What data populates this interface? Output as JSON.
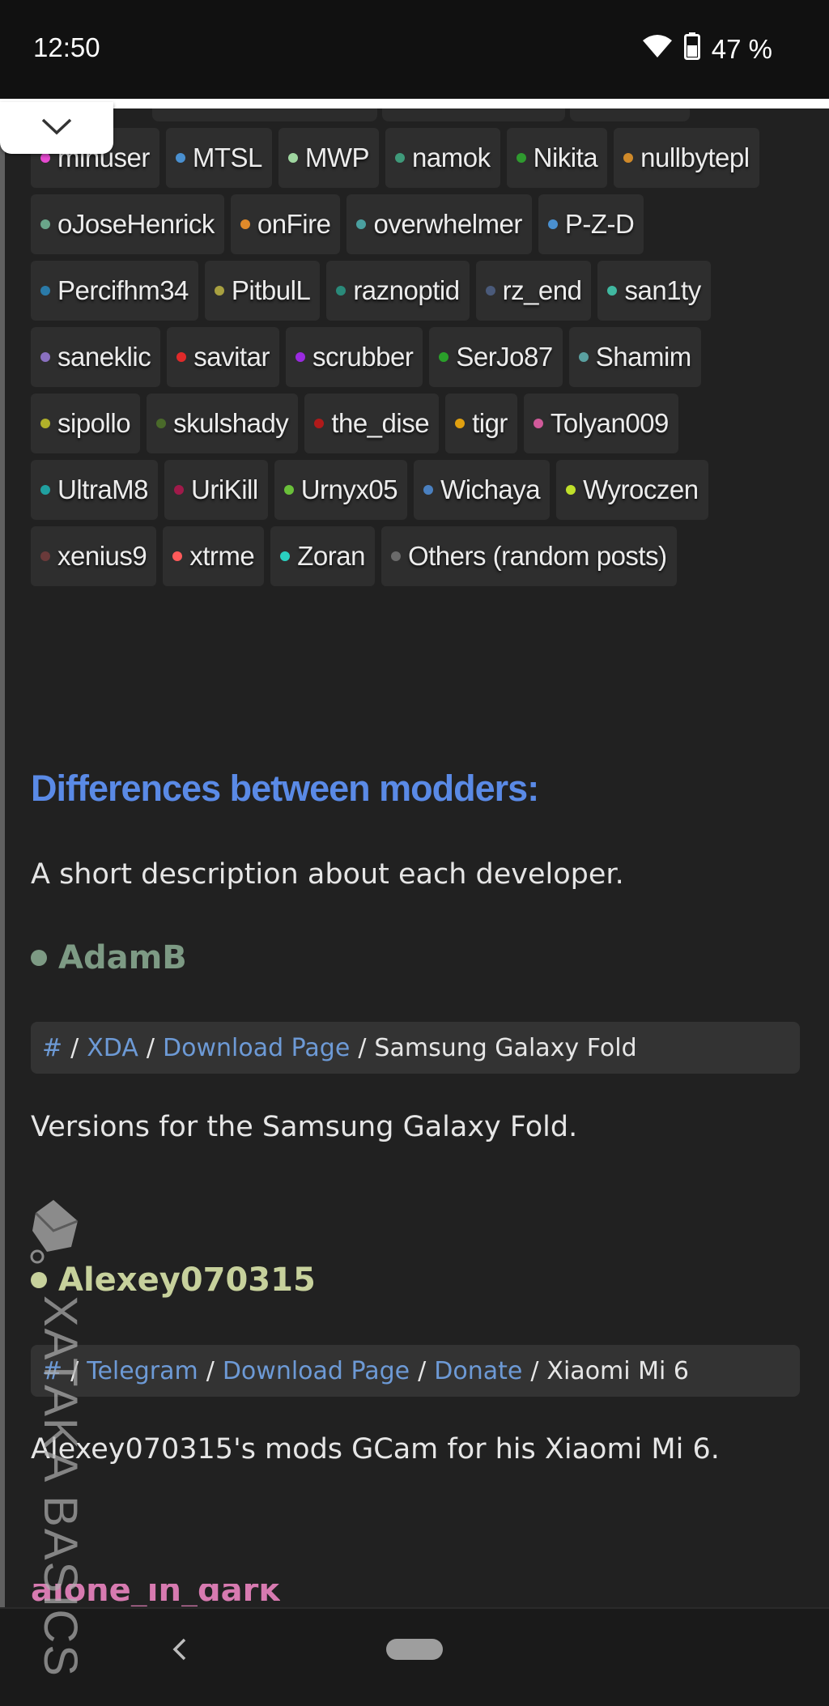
{
  "status_bar": {
    "time": "12:50",
    "battery": "47 %"
  },
  "tags": [
    {
      "label": "minuser",
      "color": "#e64ad0"
    },
    {
      "label": "MTSL",
      "color": "#4a90d0"
    },
    {
      "label": "MWP",
      "color": "#9fd6a0"
    },
    {
      "label": "namok",
      "color": "#3f9a7a"
    },
    {
      "label": "Nikita",
      "color": "#2f9a2f"
    },
    {
      "label": "nullbytepl",
      "color": "#d08a2a"
    },
    {
      "label": "oJoseHenrick",
      "color": "#6aa68a"
    },
    {
      "label": "onFire",
      "color": "#e08a2a"
    },
    {
      "label": "overwhelmer",
      "color": "#4aa0a0"
    },
    {
      "label": "P-Z-D",
      "color": "#4a90d0"
    },
    {
      "label": "Percifhm34",
      "color": "#2a7aa8"
    },
    {
      "label": "PitbulL",
      "color": "#a8a040"
    },
    {
      "label": "raznoptid",
      "color": "#2a8a7a"
    },
    {
      "label": "rz_end",
      "color": "#4a5a7a"
    },
    {
      "label": "san1ty",
      "color": "#40b8a0"
    },
    {
      "label": "saneklic",
      "color": "#8a70c0"
    },
    {
      "label": "savitar",
      "color": "#e02a2a"
    },
    {
      "label": "scrubber",
      "color": "#9a2ae0"
    },
    {
      "label": "SerJo87",
      "color": "#2aa02a"
    },
    {
      "label": "Shamim",
      "color": "#5aa0a0"
    },
    {
      "label": "sipollo",
      "color": "#b0b02a"
    },
    {
      "label": "skulshady",
      "color": "#4a6a2a"
    },
    {
      "label": "the_dise",
      "color": "#b01a1a"
    },
    {
      "label": "tigr",
      "color": "#e0a010"
    },
    {
      "label": "Tolyan009",
      "color": "#d05a9a"
    },
    {
      "label": "UltraM8",
      "color": "#20a0a0"
    },
    {
      "label": "UriKill",
      "color": "#a01a4a"
    },
    {
      "label": "Urnyx05",
      "color": "#6ac03a"
    },
    {
      "label": "Wichaya",
      "color": "#4a80c0"
    },
    {
      "label": "Wyroczen",
      "color": "#c0e02a"
    },
    {
      "label": "xenius9",
      "color": "#6a3a3a"
    },
    {
      "label": "xtrme",
      "color": "#ff5a5a"
    },
    {
      "label": "Zoran",
      "color": "#2ad0c0"
    },
    {
      "label": "Others (random posts)",
      "color": "#6a6a6a"
    }
  ],
  "section": {
    "title": "Differences between modders:",
    "description": "A short description about each developer."
  },
  "developers": [
    {
      "name": "AdamB",
      "color": "#7d9a84",
      "links": [
        "#",
        "XDA",
        "Download Page"
      ],
      "device": "Samsung Galaxy Fold",
      "description": "Versions for the Samsung Galaxy Fold."
    },
    {
      "name": "Alexey070315",
      "color": "#c7d19c",
      "links": [
        "#",
        "Telegram",
        "Download Page",
        "Donate"
      ],
      "device": "Xiaomi Mi 6",
      "description": "Alexey070315's mods GCam for his Xiaomi Mi 6."
    },
    {
      "name": "alone_in_dark",
      "color": "#d77ab0"
    }
  ],
  "watermark": "XATAKA BASICS",
  "colors": {
    "accent": "#5a8ae6",
    "link": "#6d9ad6",
    "background": "#212121"
  }
}
